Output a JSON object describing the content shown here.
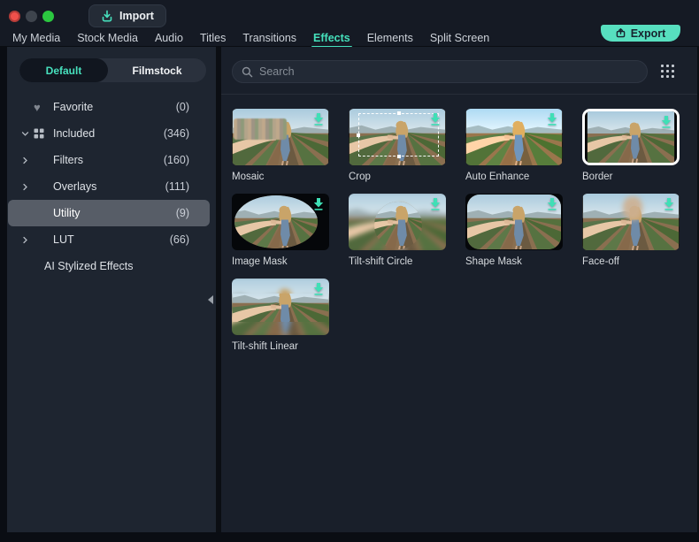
{
  "window": {
    "titlebar": {
      "traffic_lights": [
        {
          "name": "close",
          "color": "#f0504b"
        },
        {
          "name": "minimize",
          "color": "#3e444d"
        },
        {
          "name": "zoom",
          "color": "#2bc840"
        }
      ],
      "import_button": {
        "label": "Import"
      },
      "export_button": {
        "label": "Export"
      }
    },
    "tabs": {
      "items": [
        {
          "label": "My Media",
          "active": false
        },
        {
          "label": "Stock Media",
          "active": false
        },
        {
          "label": "Audio",
          "active": false
        },
        {
          "label": "Titles",
          "active": false
        },
        {
          "label": "Transitions",
          "active": false
        },
        {
          "label": "Effects",
          "active": true
        },
        {
          "label": "Elements",
          "active": false
        },
        {
          "label": "Split Screen",
          "active": false
        }
      ]
    }
  },
  "sidebar": {
    "source_toggle": {
      "selected": "Default",
      "options": [
        {
          "label": "Default"
        },
        {
          "label": "Filmstock"
        }
      ]
    },
    "categories": [
      {
        "label": "Favorite",
        "count": "(0)",
        "icon": "heart-icon",
        "selected": false
      },
      {
        "label": "Included",
        "count": "(346)",
        "icon": "category-grid-icon",
        "state": "expanded",
        "selected": false
      },
      {
        "label": "Filters",
        "count": "(160)",
        "state": "collapsed",
        "selected": false
      },
      {
        "label": "Overlays",
        "count": "(111)",
        "state": "collapsed",
        "selected": false
      },
      {
        "label": "Utility",
        "count": "(9)",
        "selected": true
      },
      {
        "label": "LUT",
        "count": "(66)",
        "state": "collapsed",
        "selected": false
      },
      {
        "label": "AI Stylized Effects",
        "count": "",
        "selected": false
      }
    ]
  },
  "content": {
    "search": {
      "placeholder": "Search"
    },
    "effects": [
      {
        "name": "Mosaic"
      },
      {
        "name": "Crop"
      },
      {
        "name": "Auto Enhance"
      },
      {
        "name": "Border"
      },
      {
        "name": "Image Mask"
      },
      {
        "name": "Tilt-shift Circle"
      },
      {
        "name": "Shape Mask"
      },
      {
        "name": "Face-off"
      },
      {
        "name": "Tilt-shift Linear"
      }
    ]
  },
  "colors": {
    "accent_teal": "#45e0bb",
    "export_button": "#57dfbf",
    "header_bg": "#151a24",
    "sidebar_bg": "#1e2530",
    "content_bg": "#191f2a",
    "selected_row": "#575d67"
  }
}
